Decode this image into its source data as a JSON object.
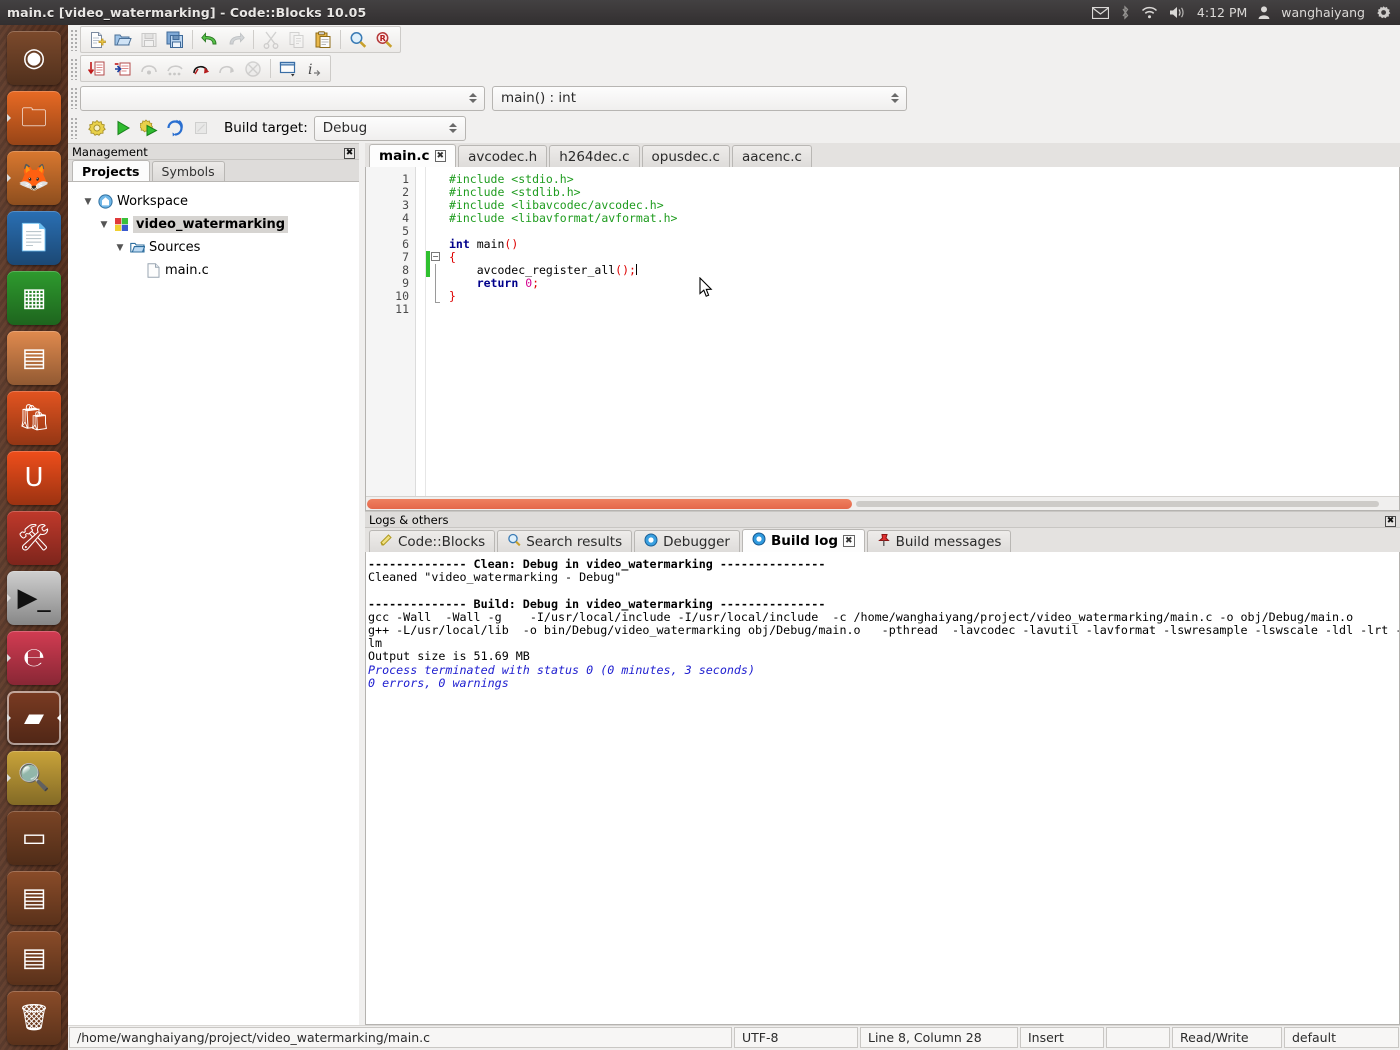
{
  "topbar": {
    "window_title": "main.c [video_watermarking] - Code::Blocks 10.05",
    "tray": {
      "mail_icon": "envelope-icon",
      "bluetooth_icon": "bluetooth-icon",
      "wifi_icon": "wifi-icon",
      "volume_icon": "volume-icon",
      "clock": "4:12 PM",
      "user_icon": "user-icon",
      "user": "wanghaiyang",
      "settings_icon": "gear-icon"
    }
  },
  "launcher": {
    "items": [
      {
        "name": "ubuntu-dash",
        "icon": "ubuntu-logo-icon",
        "glyph": "◉",
        "bg": "#7c4a2c",
        "fg": "#ffffff",
        "running": false,
        "focused": false
      },
      {
        "name": "files",
        "icon": "folder-icon",
        "glyph": "🗀",
        "bg": "#e86a24",
        "fg": "#ffffff",
        "running": true,
        "focused": false
      },
      {
        "name": "firefox",
        "icon": "firefox-icon",
        "glyph": "🦊",
        "bg": "#d9782f",
        "fg": "#ffffff",
        "running": true,
        "focused": false
      },
      {
        "name": "libreoffice-writer",
        "icon": "document-icon",
        "glyph": "📄",
        "bg": "#2a6fb3",
        "fg": "#ffffff",
        "running": false,
        "focused": false
      },
      {
        "name": "libreoffice-calc",
        "icon": "spreadsheet-icon",
        "glyph": "▦",
        "bg": "#2e9b2e",
        "fg": "#ffffff",
        "running": false,
        "focused": false
      },
      {
        "name": "libreoffice-impress",
        "icon": "presentation-icon",
        "glyph": "▤",
        "bg": "#e08a4e",
        "fg": "#ffffff",
        "running": false,
        "focused": false
      },
      {
        "name": "software-center",
        "icon": "shopping-bag-icon",
        "glyph": "🛍",
        "bg": "#e35420",
        "fg": "#ffffff",
        "running": false,
        "focused": false
      },
      {
        "name": "ubuntu-one",
        "icon": "ubuntu-one-icon",
        "glyph": "U",
        "bg": "#ef4e1b",
        "fg": "#ffffff",
        "running": false,
        "focused": false
      },
      {
        "name": "system-settings",
        "icon": "wrench-gear-icon",
        "glyph": "🛠",
        "bg": "#c0392b",
        "fg": "#ffffff",
        "running": false,
        "focused": false
      },
      {
        "name": "terminal",
        "icon": "terminal-icon",
        "glyph": "▶_",
        "bg": "#cfcfcf",
        "fg": "#111111",
        "running": true,
        "focused": false
      },
      {
        "name": "evince",
        "icon": "document-viewer-icon",
        "glyph": "℮",
        "bg": "#d23c52",
        "fg": "#ffffff",
        "running": true,
        "focused": false
      },
      {
        "name": "codeblocks",
        "icon": "codeblocks-icon",
        "glyph": "▰",
        "bg": "#7a3b22",
        "fg": "#ffffff",
        "running": true,
        "focused": true
      },
      {
        "name": "image-viewer",
        "icon": "image-search-icon",
        "glyph": "🔍",
        "bg": "#c9a33a",
        "fg": "#ffffff",
        "running": true,
        "focused": false
      },
      {
        "name": "workspace-switcher",
        "icon": "workspace-switcher-icon",
        "glyph": "▭",
        "bg": "#7a4425",
        "fg": "#ffffff",
        "running": false,
        "focused": false
      },
      {
        "name": "drive-1",
        "icon": "hard-drive-icon",
        "glyph": "▤",
        "bg": "#8a4c29",
        "fg": "#ffffff",
        "running": false,
        "focused": false
      },
      {
        "name": "drive-2",
        "icon": "hard-drive-icon",
        "glyph": "▤",
        "bg": "#8a4c29",
        "fg": "#ffffff",
        "running": false,
        "focused": false
      },
      {
        "name": "trash",
        "icon": "trash-icon",
        "glyph": "🗑",
        "bg": "#8a4c29",
        "fg": "#ffffff",
        "running": false,
        "focused": false
      }
    ]
  },
  "toolbar_main": {
    "buttons": [
      {
        "name": "new-file-button",
        "icon": "new-file-icon",
        "enabled": true
      },
      {
        "name": "open-file-button",
        "icon": "open-folder-icon",
        "enabled": true
      },
      {
        "name": "save-button",
        "icon": "floppy-save-icon",
        "enabled": false
      },
      {
        "name": "save-all-button",
        "icon": "save-all-icon",
        "enabled": true
      },
      {
        "name": "undo-button",
        "icon": "undo-arrow-icon",
        "enabled": true
      },
      {
        "name": "redo-button",
        "icon": "redo-arrow-icon",
        "enabled": false
      },
      {
        "name": "cut-button",
        "icon": "scissors-icon",
        "enabled": false
      },
      {
        "name": "copy-button",
        "icon": "copy-icon",
        "enabled": false
      },
      {
        "name": "paste-button",
        "icon": "clipboard-paste-icon",
        "enabled": true
      },
      {
        "name": "find-button",
        "icon": "magnifier-icon",
        "enabled": true
      },
      {
        "name": "replace-button",
        "icon": "magnifier-replace-icon",
        "enabled": true
      }
    ]
  },
  "toolbar_debug": {
    "buttons": [
      {
        "name": "debug-continue-button",
        "icon": "red-down-arrow-page-icon",
        "enabled": true
      },
      {
        "name": "run-to-cursor-button",
        "icon": "run-to-cursor-icon",
        "enabled": true
      },
      {
        "name": "next-line-button",
        "icon": "step-over-icon",
        "enabled": false
      },
      {
        "name": "next-instruction-button",
        "icon": "step-instruction-icon",
        "enabled": false
      },
      {
        "name": "step-into-button",
        "icon": "step-into-icon",
        "enabled": true
      },
      {
        "name": "step-out-button",
        "icon": "step-out-icon",
        "enabled": false
      },
      {
        "name": "stop-debugger-button",
        "icon": "stop-debugger-icon",
        "enabled": false
      },
      {
        "name": "debugging-windows-button",
        "icon": "debug-window-icon",
        "enabled": true
      },
      {
        "name": "debugger-info-button",
        "icon": "info-icon",
        "enabled": true
      }
    ]
  },
  "navigation": {
    "scope_combo_value": "",
    "function_combo_value": "main() : int"
  },
  "build_toolbar": {
    "buttons": [
      {
        "name": "build-button",
        "icon": "gear-build-icon"
      },
      {
        "name": "run-button",
        "icon": "green-play-icon"
      },
      {
        "name": "build-and-run-button",
        "icon": "gear-play-icon"
      },
      {
        "name": "rebuild-button",
        "icon": "rebuild-icon"
      },
      {
        "name": "abort-button",
        "icon": "abort-icon"
      }
    ],
    "label": "Build target:",
    "target_value": "Debug"
  },
  "management": {
    "caption": "Management",
    "close_icon": "close-icon",
    "tabs": [
      {
        "label": "Projects",
        "selected": true
      },
      {
        "label": "Symbols",
        "selected": false
      }
    ],
    "tree": [
      {
        "label": "Workspace",
        "depth": 0,
        "expander": "▼",
        "icon": "workspace-icon",
        "selected": false
      },
      {
        "label": "video_watermarking",
        "depth": 1,
        "expander": "▼",
        "icon": "project-icon",
        "selected": true
      },
      {
        "label": "Sources",
        "depth": 2,
        "expander": "▼",
        "icon": "folder-open-icon",
        "selected": false
      },
      {
        "label": "main.c",
        "depth": 3,
        "expander": "",
        "icon": "file-icon",
        "selected": false
      }
    ]
  },
  "editor": {
    "tabs": [
      {
        "label": "main.c",
        "selected": true,
        "close_icon": "close-icon"
      },
      {
        "label": "avcodec.h",
        "selected": false
      },
      {
        "label": "h264dec.c",
        "selected": false
      },
      {
        "label": "opusdec.c",
        "selected": false
      },
      {
        "label": "aacenc.c",
        "selected": false
      }
    ],
    "line_numbers": [
      "1",
      "2",
      "3",
      "4",
      "5",
      "6",
      "7",
      "8",
      "9",
      "10",
      "11"
    ],
    "lines": [
      "#include <stdio.h>",
      "#include <stdlib.h>",
      "#include <libavcodec/avcodec.h>",
      "#include <libavformat/avformat.h>",
      "",
      "int main()",
      "{",
      "    avcodec_register_all();",
      "    return 0;",
      "}",
      ""
    ],
    "fold_marker": "−"
  },
  "logs": {
    "caption": "Logs & others",
    "close_icon": "close-icon",
    "tabs": [
      {
        "label": "Code::Blocks",
        "icon": "codeblocks-log-icon",
        "selected": false
      },
      {
        "label": "Search results",
        "icon": "magnifier-icon",
        "selected": false
      },
      {
        "label": "Debugger",
        "icon": "debugger-icon",
        "selected": false
      },
      {
        "label": "Build log",
        "icon": "build-log-icon",
        "selected": true,
        "close_icon": "close-icon"
      },
      {
        "label": "Build messages",
        "icon": "pushpin-icon",
        "selected": false
      }
    ],
    "build_log": [
      {
        "text": "-------------- Clean: Debug in video_watermarking ---------------",
        "style": "bold"
      },
      {
        "text": "Cleaned \"video_watermarking - Debug\"",
        "style": "normal"
      },
      {
        "text": "",
        "style": "normal"
      },
      {
        "text": "-------------- Build: Debug in video_watermarking ---------------",
        "style": "bold"
      },
      {
        "text": "gcc -Wall  -Wall -g    -I/usr/local/include -I/usr/local/include  -c /home/wanghaiyang/project/video_watermarking/main.c -o obj/Debug/main.o",
        "style": "normal"
      },
      {
        "text": "g++ -L/usr/local/lib  -o bin/Debug/video_watermarking obj/Debug/main.o   -pthread  -lavcodec -lavutil -lavformat -lswresample -lswscale -ldl -lrt -",
        "style": "normal"
      },
      {
        "text": "lm",
        "style": "normal"
      },
      {
        "text": "Output size is 51.69 MB",
        "style": "normal"
      },
      {
        "text": "Process terminated with status 0 (0 minutes, 3 seconds)",
        "style": "italic-blue"
      },
      {
        "text": "0 errors, 0 warnings",
        "style": "italic-blue"
      }
    ]
  },
  "statusbar": {
    "file_path": "/home/wanghaiyang/project/video_watermarking/main.c",
    "encoding": "UTF-8",
    "caret_position": "Line 8, Column 28",
    "insert_mode": "Insert",
    "blank": "",
    "readwrite": "Read/Write",
    "profile": "default"
  },
  "colors": {
    "panel_bg": "#f0efee",
    "topbar_bg": "#3b3839",
    "launcher_bg": "#51301f",
    "accent_orange": "#e4674a",
    "comment_green": "#1f9c1f",
    "keyword_blue": "#00008b",
    "number_magenta": "#d4008f",
    "log_italic_blue": "#2020d0"
  }
}
